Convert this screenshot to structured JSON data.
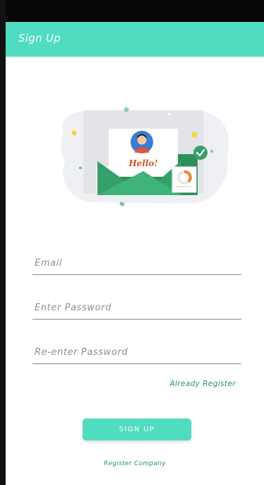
{
  "appbar": {
    "title": "Sign Up"
  },
  "illustration": {
    "greeting": "Hello!"
  },
  "form": {
    "email_placeholder": "Email",
    "password_placeholder": "Enter Password",
    "reenter_password_placeholder": "Re-enter Password"
  },
  "links": {
    "already_register": "Already Register",
    "register_company": "Register Company"
  },
  "actions": {
    "signup_label": "SIGN UP"
  },
  "colors": {
    "accent": "#4fdcbf",
    "link": "#248d78",
    "status_bar": "#060606"
  }
}
